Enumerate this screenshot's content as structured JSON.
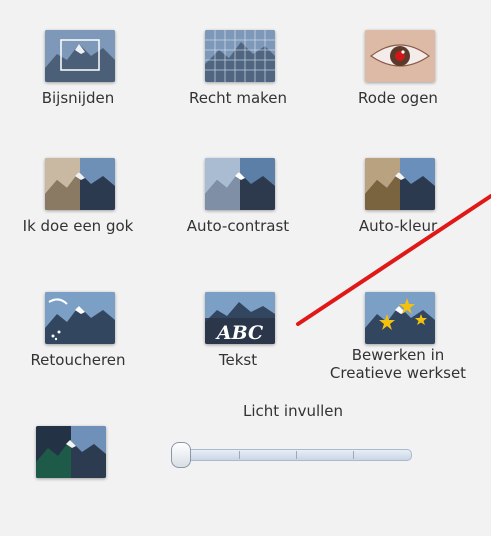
{
  "tools": [
    {
      "id": "crop",
      "label": "Bijsnijden"
    },
    {
      "id": "straighten",
      "label": "Recht maken"
    },
    {
      "id": "redeye",
      "label": "Rode ogen"
    },
    {
      "id": "lucky",
      "label": "Ik doe een gok"
    },
    {
      "id": "autocontrast",
      "label": "Auto-contrast"
    },
    {
      "id": "autocolor",
      "label": "Auto-kleur"
    },
    {
      "id": "retouch",
      "label": "Retoucheren"
    },
    {
      "id": "text",
      "label": "Tekst",
      "thumb_text": "ABC"
    },
    {
      "id": "creative",
      "label_line1": "Bewerken in",
      "label_line2": "Creatieve werkset"
    }
  ],
  "fill_light": {
    "label": "Licht invullen",
    "value": 0
  },
  "colors": {
    "annotation": "#e01818",
    "background": "#f2f2f2"
  }
}
